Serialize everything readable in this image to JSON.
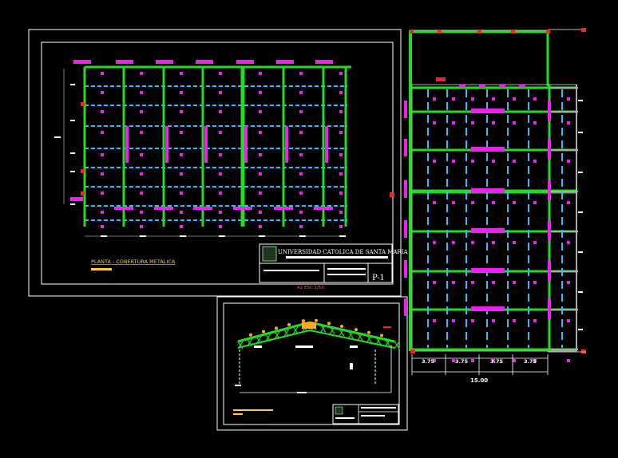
{
  "drawing": {
    "plan_title": "PLANTA - COBERTURA METALICA",
    "scale_note": "A1 ESC 1/50",
    "university": "UNIVERSIDAD CATOLICA DE SANTA MARIA",
    "sheet_code": "P-1",
    "dims_right": [
      "3.75",
      "3.75",
      "3.75",
      "3.75"
    ],
    "total_width": "15.00"
  },
  "colors": {
    "background": "#000000",
    "frame": "#ffffff",
    "beam": "#22dd22",
    "joist": "#33bbff",
    "connection": "#ee22ee",
    "marker": "#ff2222",
    "dimension": "#999999",
    "label": "#ffcc44",
    "truss": "#22dd22"
  }
}
